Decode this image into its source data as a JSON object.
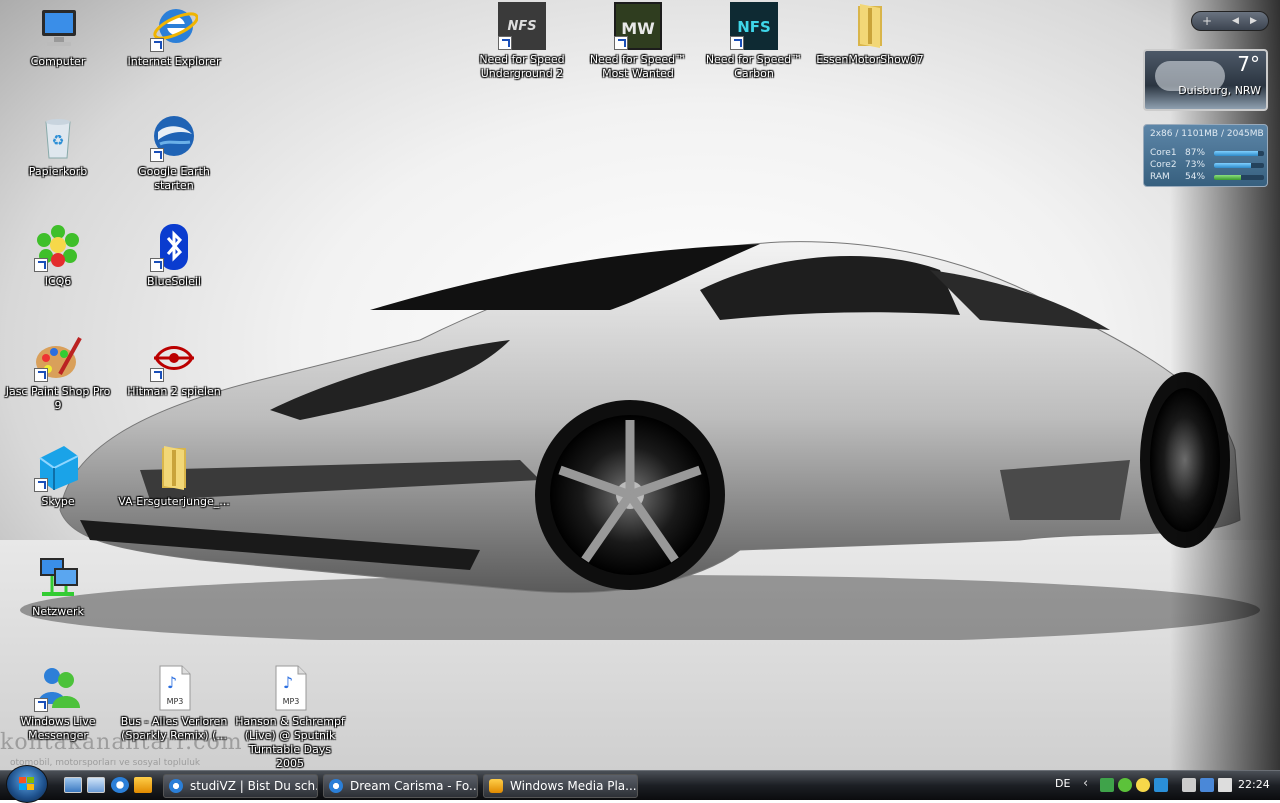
{
  "desktop_icons": [
    {
      "id": "computer",
      "label": "Computer"
    },
    {
      "id": "ie",
      "label": "Internet Explorer"
    },
    {
      "id": "nfs-ug2",
      "label": "Need for Speed Underground 2",
      "art": "NFS"
    },
    {
      "id": "nfs-mw",
      "label": "Need for Speed™ Most Wanted",
      "art": "MW"
    },
    {
      "id": "nfs-carbon",
      "label": "Need for Speed™ Carbon",
      "art": "NFS"
    },
    {
      "id": "essen",
      "label": "EssenMotorShow07"
    },
    {
      "id": "recycle",
      "label": "Papierkorb"
    },
    {
      "id": "earth",
      "label": "Google Earth starten"
    },
    {
      "id": "icq",
      "label": "ICQ6"
    },
    {
      "id": "bluesoleil",
      "label": "BlueSoleil"
    },
    {
      "id": "psp",
      "label": "Jasc Paint Shop Pro 9"
    },
    {
      "id": "hitman",
      "label": "Hitman 2 spielen"
    },
    {
      "id": "skype",
      "label": "Skype"
    },
    {
      "id": "va-folder",
      "label": "VA-Ersguterjunge_..."
    },
    {
      "id": "network",
      "label": "Netzwerk"
    },
    {
      "id": "wlm",
      "label": "Windows Live Messenger"
    },
    {
      "id": "mp3-bus",
      "label": "Bus - Alles Verloren (Sparkly Remix) (...",
      "art": "MP3"
    },
    {
      "id": "mp3-hanson",
      "label": "Hanson & Schrempf (Live) @ Sputnik Turntable Days 2005",
      "art": "MP3"
    }
  ],
  "watermark": {
    "main": "kontakanantarr.com",
    "sub": "otomobil, motorsporları ve sosyal topluluk"
  },
  "sidebar": {
    "controls": {
      "add": "+",
      "prev": "◀",
      "next": "▶"
    },
    "weather": {
      "temp": "7°",
      "city": "Duisburg, NRW"
    },
    "meter": {
      "header": "2x86 / 1101MB / 2045MB",
      "rows": [
        {
          "name": "Core1",
          "pct": "87%",
          "value": 87
        },
        {
          "name": "Core2",
          "pct": "73%",
          "value": 73
        },
        {
          "name": "RAM",
          "pct": "54%",
          "value": 54
        }
      ]
    }
  },
  "taskbar": {
    "tasks": [
      {
        "label": "studiVZ | Bist Du sch...",
        "icon": "ie-icon"
      },
      {
        "label": "Dream Carisma - Fo...",
        "icon": "ie-icon"
      },
      {
        "label": "Windows Media Pla...",
        "icon": "media-player-icon"
      }
    ],
    "language": "DE",
    "chevron": "‹",
    "clock": "22:24"
  },
  "colors": {
    "taskbar": "#1c1f24",
    "accent": "#1d4f8a",
    "meter": "#37607f"
  }
}
